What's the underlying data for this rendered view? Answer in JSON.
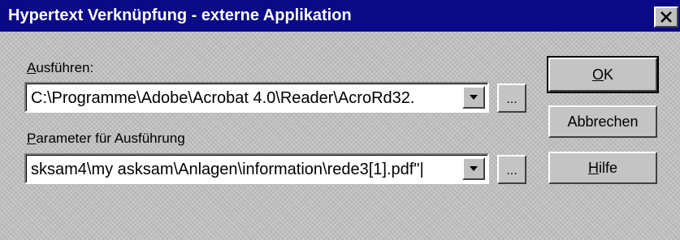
{
  "window": {
    "title": "Hypertext Verknüpfung - externe Applikation",
    "close_glyph": "✕"
  },
  "exec": {
    "label_accel": "A",
    "label_rest": "usführen:",
    "value": "C:\\Programme\\Adobe\\Acrobat 4.0\\Reader\\AcroRd32.",
    "browse_label": "..."
  },
  "params": {
    "label_accel": "P",
    "label_rest": "arameter für Ausführung",
    "value": "sksam4\\my asksam\\Anlagen\\information\\rede3[1].pdf\"|",
    "browse_label": "..."
  },
  "buttons": {
    "ok_accel": "O",
    "ok_rest": "K",
    "cancel_label": "Abbrechen",
    "help_accel": "H",
    "help_rest": "ilfe"
  },
  "colors": {
    "titlebar": "#0a0a86",
    "face": "#c4c4c4"
  }
}
